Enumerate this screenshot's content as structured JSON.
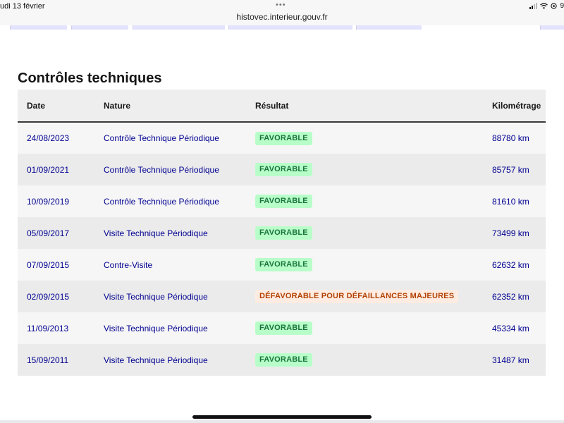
{
  "status_bar": {
    "time_text": "udi 13 février",
    "dots": "•••",
    "url": "histovec.interieur.gouv.fr",
    "battery_text": "9"
  },
  "section": {
    "title": "Contrôles techniques"
  },
  "table": {
    "headers": {
      "date": "Date",
      "nature": "Nature",
      "resultat": "Résultat",
      "kilometrage": "Kilométrage"
    },
    "rows": [
      {
        "date": "24/08/2023",
        "nature": "Contrôle Technique Périodique",
        "resultat": "FAVORABLE",
        "status": "ok",
        "km": "88780 km"
      },
      {
        "date": "01/09/2021",
        "nature": "Contrôle Technique Périodique",
        "resultat": "FAVORABLE",
        "status": "ok",
        "km": "85757 km"
      },
      {
        "date": "10/09/2019",
        "nature": "Contrôle Technique Périodique",
        "resultat": "FAVORABLE",
        "status": "ok",
        "km": "81610 km"
      },
      {
        "date": "05/09/2017",
        "nature": "Visite Technique Périodique",
        "resultat": "FAVORABLE",
        "status": "ok",
        "km": "73499 km"
      },
      {
        "date": "07/09/2015",
        "nature": "Contre-Visite",
        "resultat": "FAVORABLE",
        "status": "ok",
        "km": "62632 km"
      },
      {
        "date": "02/09/2015",
        "nature": "Visite Technique Périodique",
        "resultat": "DÉFAVORABLE POUR DÉFAILLANCES MAJEURES",
        "status": "ko",
        "km": "62352 km"
      },
      {
        "date": "11/09/2013",
        "nature": "Visite Technique Périodique",
        "resultat": "FAVORABLE",
        "status": "ok",
        "km": "45334 km"
      },
      {
        "date": "15/09/2011",
        "nature": "Visite Technique Périodique",
        "resultat": "FAVORABLE",
        "status": "ok",
        "km": "31487 km"
      }
    ]
  },
  "colors": {
    "link_blue": "#000091",
    "favorable_bg": "#b8fec9",
    "favorable_text": "#18753c",
    "defavorable_bg": "#feece2",
    "defavorable_text": "#b34000"
  }
}
